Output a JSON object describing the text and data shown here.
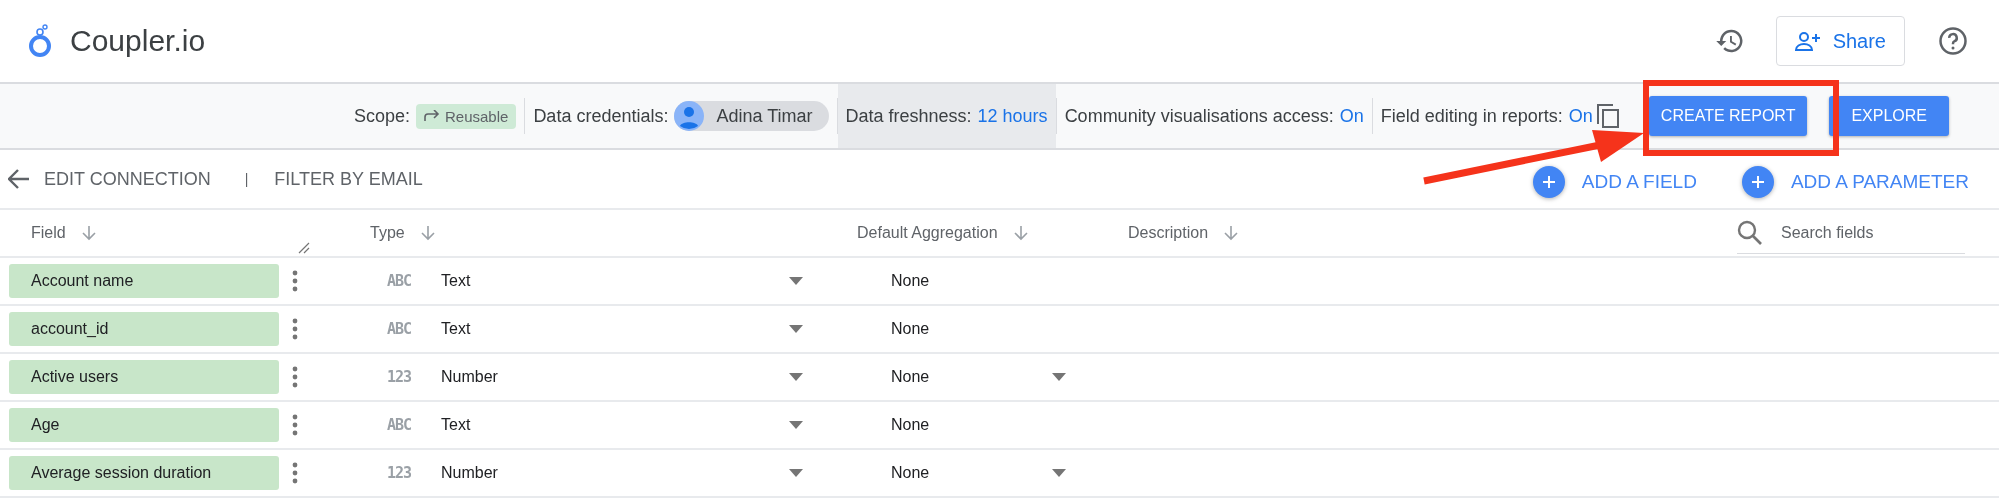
{
  "app": {
    "title": "Coupler.io",
    "share_label": "Share"
  },
  "toolbar": {
    "scope_label": "Scope:",
    "scope_chip": "Reusable",
    "credentials_label": "Data credentials:",
    "credentials_user": "Adina Timar",
    "freshness_label": "Data freshness:",
    "freshness_value": "12 hours",
    "community_label": "Community visualisations access:",
    "community_value": "On",
    "editing_label": "Field editing in reports:",
    "editing_value": "On",
    "create_button": "CREATE REPORT",
    "explore_button": "EXPLORE"
  },
  "nav": {
    "edit_link": "EDIT CONNECTION",
    "separator": "|",
    "filter_link": "FILTER BY EMAIL",
    "add_field": "ADD A FIELD",
    "add_parameter": "ADD A PARAMETER"
  },
  "table": {
    "columns": [
      "Field",
      "Type",
      "Default Aggregation",
      "Description"
    ],
    "search": {
      "placeholder": "Search fields"
    },
    "rows": [
      {
        "field": "Account name",
        "type_icon": "ABC",
        "type": "Text",
        "aggregation": "None",
        "aggregation_dropdown": false
      },
      {
        "field": "account_id",
        "type_icon": "ABC",
        "type": "Text",
        "aggregation": "None",
        "aggregation_dropdown": false
      },
      {
        "field": "Active users",
        "type_icon": "123",
        "type": "Number",
        "aggregation": "None",
        "aggregation_dropdown": true
      },
      {
        "field": "Age",
        "type_icon": "ABC",
        "type": "Text",
        "aggregation": "None",
        "aggregation_dropdown": false
      },
      {
        "field": "Average session duration",
        "type_icon": "123",
        "type": "Number",
        "aggregation": "None",
        "aggregation_dropdown": true
      }
    ]
  }
}
